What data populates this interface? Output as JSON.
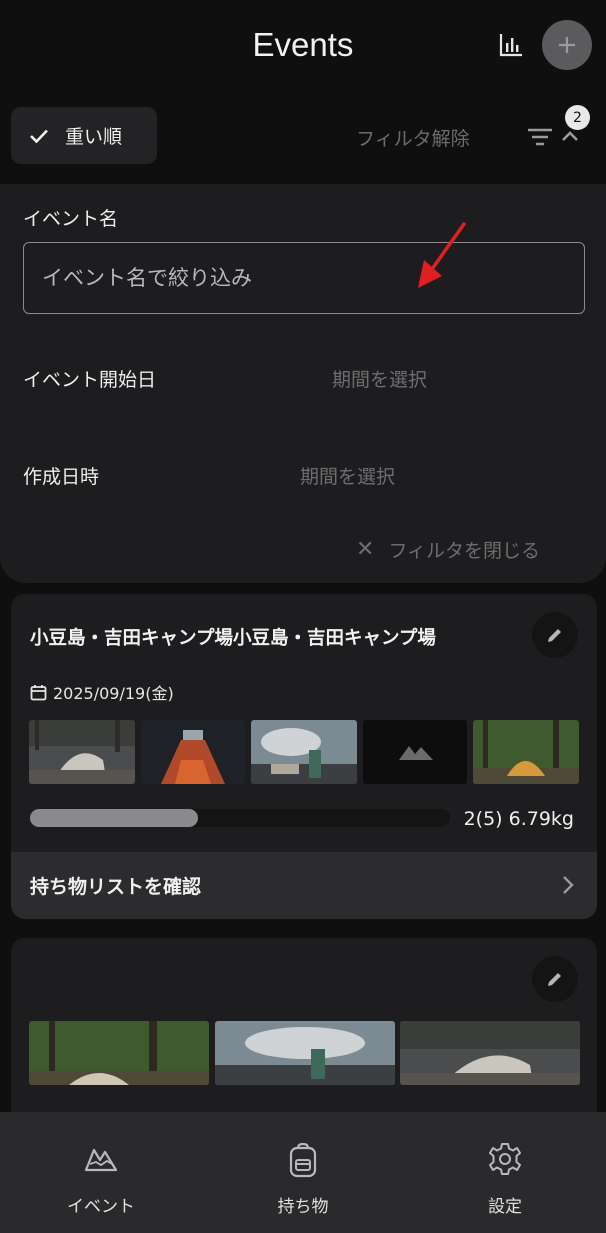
{
  "header": {
    "title": "Events"
  },
  "sort": {
    "label": "重い順"
  },
  "filter": {
    "clear_label": "フィルタ解除",
    "badge_count": "2",
    "event_name_label": "イベント名",
    "event_name_placeholder": "イベント名で絞り込み",
    "event_start_label": "イベント開始日",
    "event_start_value": "期間を選択",
    "created_label": "作成日時",
    "created_value": "期間を選択",
    "close_label": "フィルタを閉じる"
  },
  "events": [
    {
      "title": "小豆島・吉田キャンプ場小豆島・吉田キャンプ場",
      "date": "2025/09/19(金)",
      "weight_text": "2(5) 6.79kg",
      "progress": 0.4,
      "footer_label": "持ち物リストを確認"
    },
    {
      "title": ""
    }
  ],
  "nav": {
    "items": [
      {
        "label": "イベント",
        "icon": "mountain-icon"
      },
      {
        "label": "持ち物",
        "icon": "backpack-icon"
      },
      {
        "label": "設定",
        "icon": "gear-icon"
      }
    ]
  },
  "colors": {
    "background": "#0f0f10",
    "surface": "#1d1d1f",
    "accent_arrow": "#e02020"
  }
}
